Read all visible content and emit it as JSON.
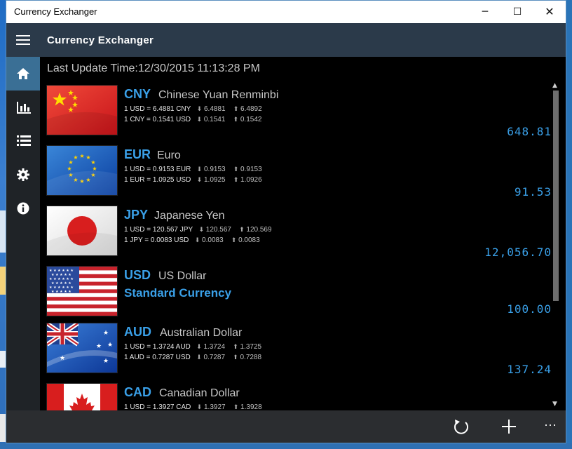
{
  "window": {
    "title": "Currency Exchanger",
    "minimize_glyph": "─",
    "maximize_glyph": "☐",
    "close_glyph": "✕"
  },
  "appbar": {
    "title": "Currency Exchanger"
  },
  "nav": [
    {
      "icon": "home-icon",
      "active": true
    },
    {
      "icon": "chart-icon",
      "active": false
    },
    {
      "icon": "list-icon",
      "active": false
    },
    {
      "icon": "gear-icon",
      "active": false
    },
    {
      "icon": "info-icon",
      "active": false
    }
  ],
  "last_update": "Last Update Time:12/30/2015 11:13:28 PM",
  "currencies": [
    {
      "code": "CNY",
      "name": "Chinese Yuan Renminbi",
      "flag": "china",
      "line1": "1 USD = 6.4881 CNY",
      "line1_down": "6.4881",
      "line1_up": "6.4892",
      "line2": "1 CNY = 0.1541 USD",
      "line2_down": "0.1541",
      "line2_up": "0.1542",
      "amount": "648.81"
    },
    {
      "code": "EUR",
      "name": "Euro",
      "flag": "eu",
      "line1": "1 USD = 0.9153 EUR",
      "line1_down": "0.9153",
      "line1_up": "0.9153",
      "line2": "1 EUR = 1.0925 USD",
      "line2_down": "1.0925",
      "line2_up": "1.0926",
      "amount": "91.53"
    },
    {
      "code": "JPY",
      "name": "Japanese Yen",
      "flag": "japan",
      "line1": "1 USD = 120.567 JPY",
      "line1_down": "120.567",
      "line1_up": "120.569",
      "line2": "1 JPY = 0.0083 USD",
      "line2_down": "0.0083",
      "line2_up": "0.0083",
      "amount": "12,056.70"
    },
    {
      "code": "USD",
      "name": "US Dollar",
      "flag": "usa",
      "standard_label": "Standard Currency",
      "amount": "100.00"
    },
    {
      "code": "AUD",
      "name": "Australian Dollar",
      "flag": "australia",
      "line1": "1 USD = 1.3724 AUD",
      "line1_down": "1.3724",
      "line1_up": "1.3725",
      "line2": "1 AUD = 0.7287 USD",
      "line2_down": "0.7287",
      "line2_up": "0.7288",
      "amount": "137.24"
    },
    {
      "code": "CAD",
      "name": "Canadian Dollar",
      "flag": "canada",
      "line1": "1 USD = 1.3927 CAD",
      "line1_down": "1.3927",
      "line1_up": "1.3928"
    }
  ],
  "bottom_bar": {
    "refresh_icon": "refresh-icon",
    "add_icon": "add-icon",
    "more_label": "···"
  },
  "colors": {
    "accent": "#3aa0e8",
    "appbar": "#2b3a4a",
    "nav_active": "#3a6f95",
    "background": "#000000"
  }
}
